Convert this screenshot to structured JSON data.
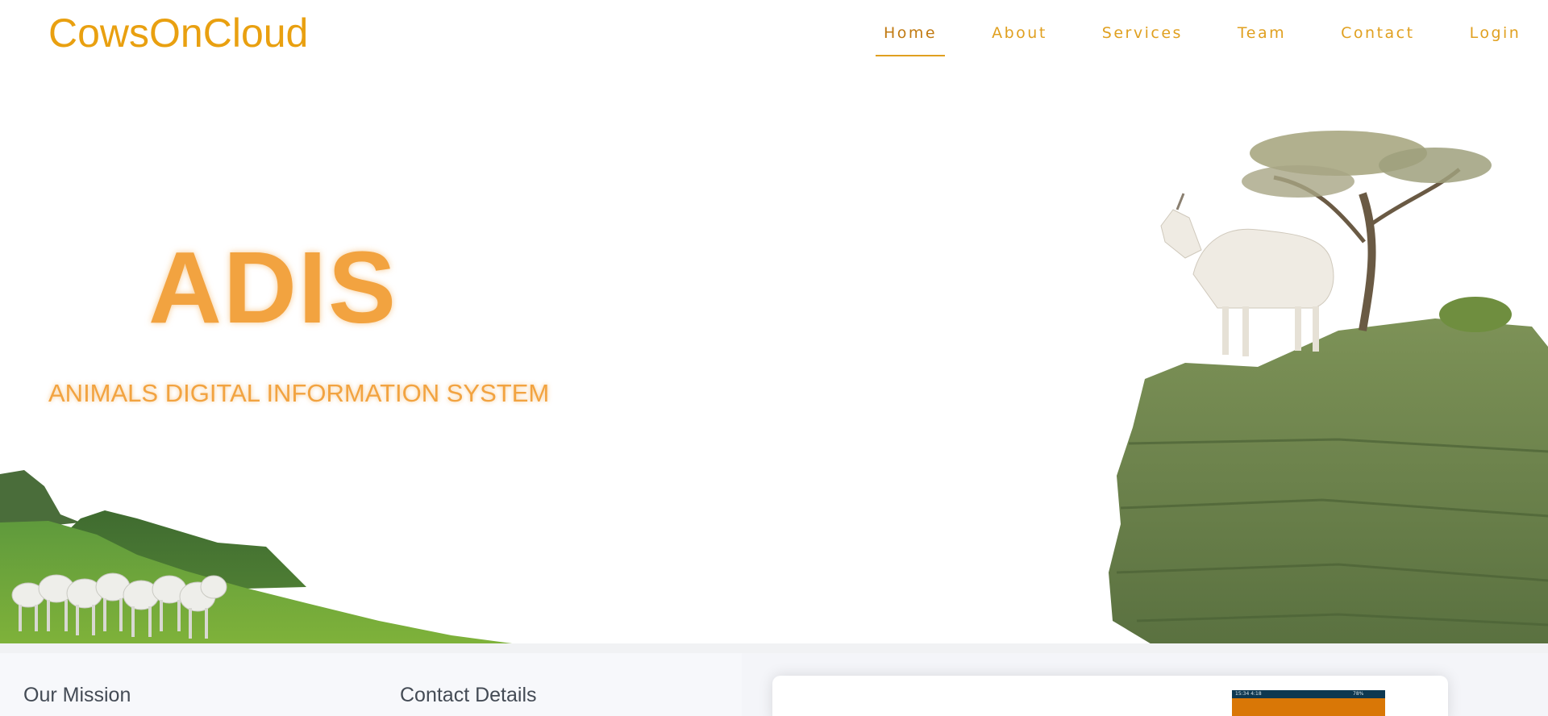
{
  "brand": {
    "name": "CowsOnCloud"
  },
  "nav": {
    "items": [
      {
        "label": "Home",
        "active": true
      },
      {
        "label": "About"
      },
      {
        "label": "Services"
      },
      {
        "label": "Team"
      },
      {
        "label": "Contact"
      },
      {
        "label": "Login"
      }
    ]
  },
  "hero": {
    "title": "ADIS",
    "subtitle": "ANIMALS DIGITAL INFORMATION SYSTEM"
  },
  "sections": {
    "mission_heading": "Our Mission",
    "contact_heading": "Contact Details"
  },
  "phone_preview": {
    "status_left": "15:34 4:18",
    "status_right": "78%"
  },
  "colors": {
    "brand": "#e9a010",
    "hero_text": "#f2a340",
    "nav_active": "#c17a12",
    "phone_header": "#0e3850",
    "phone_body": "#d97706"
  }
}
